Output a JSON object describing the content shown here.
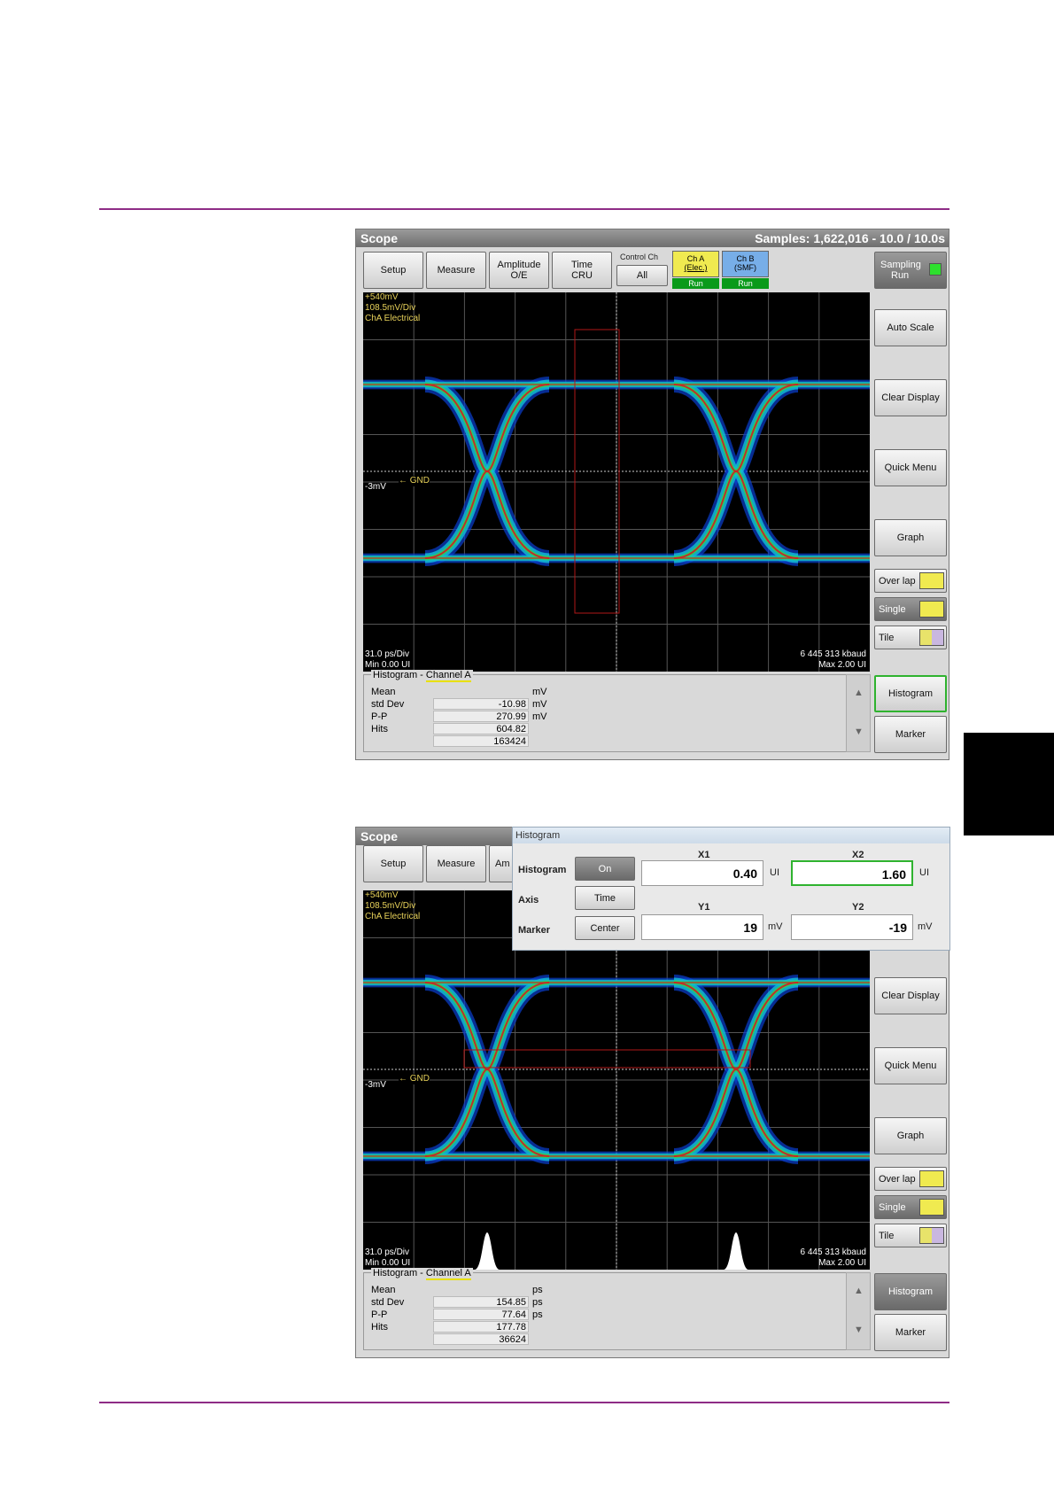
{
  "colors": {
    "rule": "#8e2c86",
    "run": "#0a9a1a",
    "yellow_btn": "#f0ea50",
    "blue_btn": "#77aee8",
    "trace_label": "#e8d25a",
    "active_border": "#2fb32f"
  },
  "w1": {
    "title": "Scope",
    "samples": "Samples: 1,622,016 - 10.0 / 10.0s",
    "top": {
      "setup": "Setup",
      "measure": "Measure",
      "amp1": "Amplitude",
      "amp2": "O/E",
      "time1": "Time",
      "time2": "CRU",
      "control": "Control Ch",
      "all": "All",
      "cha1": "Ch A",
      "cha2": "(Elec.)",
      "chb1": "Ch B",
      "chb2": "(SMF)",
      "run": "Run",
      "sampling1": "Sampling",
      "sampling2": "Run"
    },
    "side": {
      "auto": "Auto Scale",
      "clear": "Clear Display",
      "quick": "Quick Menu",
      "graph": "Graph",
      "overlap": "Over lap",
      "single": "Single",
      "tile": "Tile",
      "histogram": "Histogram",
      "marker": "Marker"
    },
    "screen": {
      "l1": "+540mV",
      "l2": "108.5mV/Div",
      "l3": "ChA  Electrical",
      "gnd": "GND",
      "offset": "-3mV",
      "xdiv": "31.0 ps/Div",
      "min": "Min 0.00 UI",
      "baud": "6 445 313 kbaud",
      "max": "Max 2.00 UI"
    },
    "hist": {
      "title": "Histogram",
      "channel": "Channel A",
      "rows": [
        {
          "name": "Mean",
          "value": "-10.98",
          "unit": "mV"
        },
        {
          "name": "std Dev",
          "value": "270.99",
          "unit": "mV"
        },
        {
          "name": "P-P",
          "value": "604.82",
          "unit": "mV"
        },
        {
          "name": "Hits",
          "value": "163424",
          "unit": ""
        }
      ]
    }
  },
  "w2": {
    "title": "Scope",
    "top": {
      "setup": "Setup",
      "measure": "Measure",
      "amp": "Am"
    },
    "popup": {
      "title": "Histogram",
      "histogram": "Histogram",
      "on": "On",
      "axis": "Axis",
      "time": "Time",
      "marker": "Marker",
      "center": "Center",
      "x1": "X1",
      "x2": "X2",
      "y1": "Y1",
      "y2": "Y2",
      "x1v": "0.40",
      "x2v": "1.60",
      "y1v": "19",
      "y2v": "-19",
      "ui": "UI",
      "mv": "mV"
    },
    "side": {
      "clear": "Clear Display",
      "quick": "Quick Menu",
      "graph": "Graph",
      "overlap": "Over lap",
      "single": "Single",
      "tile": "Tile",
      "histogram": "Histogram",
      "marker": "Marker"
    },
    "screen": {
      "l1": "+540mV",
      "l2": "108.5mV/Div",
      "l3": "ChA  Electrical",
      "gnd": "GND",
      "offset": "-3mV",
      "xdiv": "31.0 ps/Div",
      "min": "Min 0.00 UI",
      "baud": "6 445 313 kbaud",
      "max": "Max 2.00 UI"
    },
    "hist": {
      "title": "Histogram",
      "channel": "Channel A",
      "rows": [
        {
          "name": "Mean",
          "value": "154.85",
          "unit": "ps"
        },
        {
          "name": "std Dev",
          "value": "77.64",
          "unit": "ps"
        },
        {
          "name": "P-P",
          "value": "177.78",
          "unit": "ps"
        },
        {
          "name": "Hits",
          "value": "36624",
          "unit": ""
        }
      ]
    }
  }
}
